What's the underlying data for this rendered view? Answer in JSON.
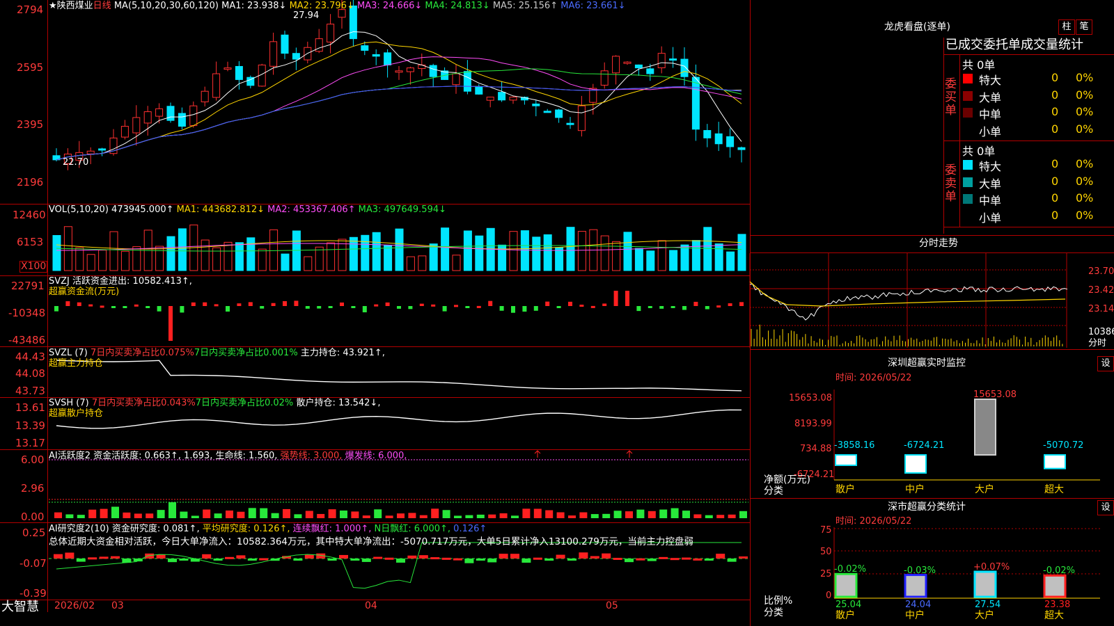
{
  "stock": {
    "name": "陕西煤业",
    "period": "日线",
    "star": "★"
  },
  "ma_line": {
    "label": "MA(5,10,20,30,60,120)",
    "ma1": "MA1: 23.938↓",
    "ma2": "MA2: 23.796↓",
    "ma3": "MA3: 24.666↓",
    "ma4": "MA4: 24.813↓",
    "ma5": "MA5: 25.156↑",
    "ma6": "MA6: 23.661↓"
  },
  "price_axis": [
    "2794",
    "2595",
    "2395",
    "2196"
  ],
  "price_annotations": {
    "high": "27.94",
    "low": "22.70"
  },
  "vol_line": {
    "label": "VOL(5,10,20)",
    "val": "473945.000↑",
    "ma1": "MA1: 443682.812↓",
    "ma2": "MA2: 453367.406↑",
    "ma3": "MA3: 497649.594↓"
  },
  "vol_axis": [
    "12460",
    "6153",
    "X100"
  ],
  "svzj": {
    "label": "SVZJ",
    "desc": "活跃资金进出: 10582.413↑,",
    "sub": "超赢资金流(万元)",
    "axis": [
      "22791",
      "-10348",
      "-43486"
    ]
  },
  "svzl": {
    "label": "SVZL (7)",
    "a": "7日内买卖净占比0.075%",
    "b": "7日内买卖净占比0.001%",
    "c": "主力持仓: 43.921↑,",
    "sub": "超赢主力持仓",
    "axis": [
      "44.43",
      "44.08",
      "43.73"
    ]
  },
  "svsh": {
    "label": "SVSH (7)",
    "a": "7日内买卖净占比0.043%",
    "b": "7日内买卖净占比0.02%",
    "c": "散户持仓: 13.542↓,",
    "sub": "超赢散户持仓",
    "axis": [
      "13.61",
      "13.39",
      "13.17"
    ]
  },
  "ai1": {
    "label": "AI活跃度2",
    "a": "资金活跃度: 0.663↑,",
    "b": "1.693,",
    "c": "生命线: 1.560,",
    "d": "强势线: 3.000,",
    "e": "爆发线: 6.000,",
    "axis": [
      "6.00",
      "2.96",
      "0.00"
    ]
  },
  "ai2": {
    "label": "AI研究度2(10)",
    "a": "资金研究度: 0.081↑,",
    "b": "平均研究度: 0.126↑,",
    "c": "连续飘红: 1.000↑,",
    "d": "N日飘红: 6.000↑,",
    "e": "0.126↑",
    "axis": [
      "0.25",
      "-0.07",
      "-0.39"
    ]
  },
  "summary": "总体近期大资金相对活跃，今日大单净流入：10582.364万元，其中特大单净流出：-5070.717万元，大单5日累计净入13100.279万元，当前主力控盘弱",
  "x_axis": {
    "brand": "大智慧",
    "labels": [
      "2026/02",
      "03",
      "04",
      "05"
    ]
  },
  "right": {
    "lhb_title": "龙虎看盘(逐单)",
    "btn_zhu": "柱",
    "btn_bi": "笔",
    "tabs": [
      "已成交",
      "委托单",
      "成交量统计"
    ],
    "buy": {
      "side": "委买单",
      "total": "共 0单",
      "rows": [
        {
          "label": "特大",
          "val": "0",
          "pct": "0%",
          "color": "#ff0000"
        },
        {
          "label": "大单",
          "val": "0",
          "pct": "0%",
          "color": "#8b0000"
        },
        {
          "label": "中单",
          "val": "0",
          "pct": "0%",
          "color": "#6b0000"
        },
        {
          "label": "小单",
          "val": "0",
          "pct": "0%",
          "color": ""
        }
      ]
    },
    "sell": {
      "side": "委卖单",
      "total": "共 0单",
      "rows": [
        {
          "label": "特大",
          "val": "0",
          "pct": "0%",
          "color": "#00e5ff"
        },
        {
          "label": "大单",
          "val": "0",
          "pct": "0%",
          "color": "#00a0a0"
        },
        {
          "label": "中单",
          "val": "0",
          "pct": "0%",
          "color": "#007878"
        },
        {
          "label": "小单",
          "val": "0",
          "pct": "0%",
          "color": ""
        }
      ]
    },
    "intraday": {
      "title": "分时走势",
      "axis": [
        "23.70",
        "23.42",
        "23.14"
      ],
      "vol": "10386",
      "vol_unit": "分时"
    },
    "sz_monitor": {
      "title": "深圳超赢实时监控",
      "btn": "设",
      "date": "时间: 2026/05/22",
      "axis": [
        "15653.08",
        "8193.99",
        "734.88",
        "-6724.21"
      ],
      "ylabel": "净额(万元)",
      "xlabel": "分类",
      "categories": [
        "散户",
        "中户",
        "大户",
        "超大"
      ],
      "values": [
        "-3858.16",
        "-6724.21",
        "15653.08",
        "-5070.72"
      ]
    },
    "sz_class": {
      "title": "深市超赢分类统计",
      "btn": "设",
      "date": "时间: 2026/05/22",
      "axis": [
        "75",
        "50",
        "25",
        "0"
      ],
      "ylabel": "比例%",
      "xlabel": "分类",
      "categories": [
        "散户",
        "中户",
        "大户",
        "超大"
      ],
      "changes": [
        "-0.02%",
        "-0.03%",
        "+0.07%",
        "-0.02%"
      ],
      "values": [
        "25.04",
        "24.04",
        "27.54",
        "23.38"
      ]
    }
  },
  "chart_data": [
    {
      "type": "table",
      "title": "深圳超赢实时监控",
      "ylabel": "净额(万元)",
      "xlabel": "分类",
      "categories": [
        "散户",
        "中户",
        "大户",
        "超大"
      ],
      "values": [
        -3858.16,
        -6724.21,
        15653.08,
        -5070.72
      ],
      "ylim": [
        -6724.21,
        15653.08
      ]
    },
    {
      "type": "bar",
      "title": "深市超赢分类统计",
      "ylabel": "比例%",
      "xlabel": "分类",
      "categories": [
        "散户",
        "中户",
        "大户",
        "超大"
      ],
      "values": [
        25.04,
        24.04,
        27.54,
        23.38
      ],
      "ylim": [
        0,
        75
      ]
    }
  ]
}
